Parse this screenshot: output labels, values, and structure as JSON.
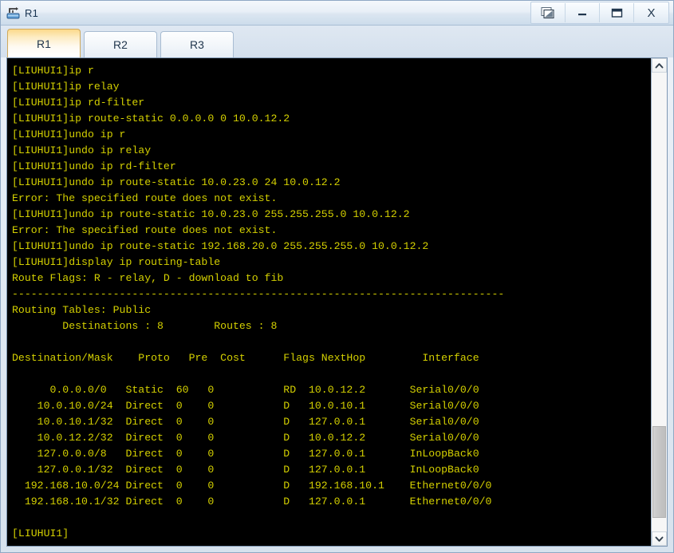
{
  "window": {
    "title": "R1",
    "app_icon": "router-icon",
    "buttons": [
      {
        "name": "restore-windows-button",
        "icon": "cascade-windows-icon",
        "label": ""
      },
      {
        "name": "minimize-button",
        "icon": "minimize-icon",
        "label": ""
      },
      {
        "name": "maximize-button",
        "icon": "maximize-icon",
        "label": ""
      },
      {
        "name": "close-button",
        "icon": "close-icon",
        "label": "X"
      }
    ]
  },
  "tabs": [
    {
      "label": "R1",
      "active": true
    },
    {
      "label": "R2",
      "active": false
    },
    {
      "label": "R3",
      "active": false
    }
  ],
  "terminal": {
    "prompt": "[LIUHUI1]",
    "text_color": "#d4d000",
    "background_color": "#000000",
    "content": "[LIUHUI1]ip r\n[LIUHUI1]ip relay\n[LIUHUI1]ip rd-filter\n[LIUHUI1]ip route-static 0.0.0.0 0 10.0.12.2\n[LIUHUI1]undo ip r\n[LIUHUI1]undo ip relay\n[LIUHUI1]undo ip rd-filter\n[LIUHUI1]undo ip route-static 10.0.23.0 24 10.0.12.2\nError: The specified route does not exist.\n[LIUHUI1]undo ip route-static 10.0.23.0 255.255.255.0 10.0.12.2\nError: The specified route does not exist.\n[LIUHUI1]undo ip route-static 192.168.20.0 255.255.255.0 10.0.12.2\n[LIUHUI1]display ip routing-table\nRoute Flags: R - relay, D - download to fib\n------------------------------------------------------------------------------\nRouting Tables: Public\n        Destinations : 8        Routes : 8\n\nDestination/Mask    Proto   Pre  Cost      Flags NextHop         Interface\n\n      0.0.0.0/0   Static  60   0           RD  10.0.12.2       Serial0/0/0\n    10.0.10.0/24  Direct  0    0           D   10.0.10.1       Serial0/0/0\n    10.0.10.1/32  Direct  0    0           D   127.0.0.1       Serial0/0/0\n    10.0.12.2/32  Direct  0    0           D   10.0.12.2       Serial0/0/0\n    127.0.0.0/8   Direct  0    0           D   127.0.0.1       InLoopBack0\n    127.0.0.1/32  Direct  0    0           D   127.0.0.1       InLoopBack0\n  192.168.10.0/24 Direct  0    0           D   192.168.10.1    Ethernet0/0/0\n  192.168.10.1/32 Direct  0    0           D   127.0.0.1       Ethernet0/0/0\n\n[LIUHUI1]"
  },
  "scrollbar": {
    "up_icon": "chevron-up-icon",
    "down_icon": "chevron-down-icon",
    "thumb_top_percent": 77,
    "thumb_height_percent": 20
  },
  "routing_table": {
    "route_flags_legend": "Route Flags: R - relay, D - download to fib",
    "table_name": "Routing Tables: Public",
    "destinations": 8,
    "routes": 8,
    "columns": [
      "Destination/Mask",
      "Proto",
      "Pre",
      "Cost",
      "Flags",
      "NextHop",
      "Interface"
    ],
    "rows": [
      [
        "0.0.0.0/0",
        "Static",
        "60",
        "0",
        "RD",
        "10.0.12.2",
        "Serial0/0/0"
      ],
      [
        "10.0.10.0/24",
        "Direct",
        "0",
        "0",
        "D",
        "10.0.10.1",
        "Serial0/0/0"
      ],
      [
        "10.0.10.1/32",
        "Direct",
        "0",
        "0",
        "D",
        "127.0.0.1",
        "Serial0/0/0"
      ],
      [
        "10.0.12.2/32",
        "Direct",
        "0",
        "0",
        "D",
        "10.0.12.2",
        "Serial0/0/0"
      ],
      [
        "127.0.0.0/8",
        "Direct",
        "0",
        "0",
        "D",
        "127.0.0.1",
        "InLoopBack0"
      ],
      [
        "127.0.0.1/32",
        "Direct",
        "0",
        "0",
        "D",
        "127.0.0.1",
        "InLoopBack0"
      ],
      [
        "192.168.10.0/24",
        "Direct",
        "0",
        "0",
        "D",
        "192.168.10.1",
        "Ethernet0/0/0"
      ],
      [
        "192.168.10.1/32",
        "Direct",
        "0",
        "0",
        "D",
        "127.0.0.1",
        "Ethernet0/0/0"
      ]
    ]
  }
}
